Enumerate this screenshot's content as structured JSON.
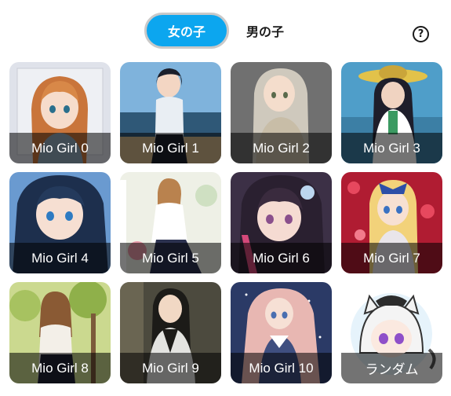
{
  "tabs": [
    {
      "label": "女の子",
      "active": true
    },
    {
      "label": "男の子",
      "active": false
    }
  ],
  "help_icon": "question-circle-icon",
  "accent_color": "#0ca6ef",
  "characters": [
    {
      "label": "Mio Girl 0"
    },
    {
      "label": "Mio Girl 1"
    },
    {
      "label": "Mio Girl 2"
    },
    {
      "label": "Mio Girl 3"
    },
    {
      "label": "Mio Girl 4"
    },
    {
      "label": "Mio Girl 5"
    },
    {
      "label": "Mio Girl 6"
    },
    {
      "label": "Mio Girl 7"
    },
    {
      "label": "Mio Girl 8"
    },
    {
      "label": "Mio Girl 9"
    },
    {
      "label": "Mio Girl 10"
    },
    {
      "label": "ランダム"
    }
  ]
}
